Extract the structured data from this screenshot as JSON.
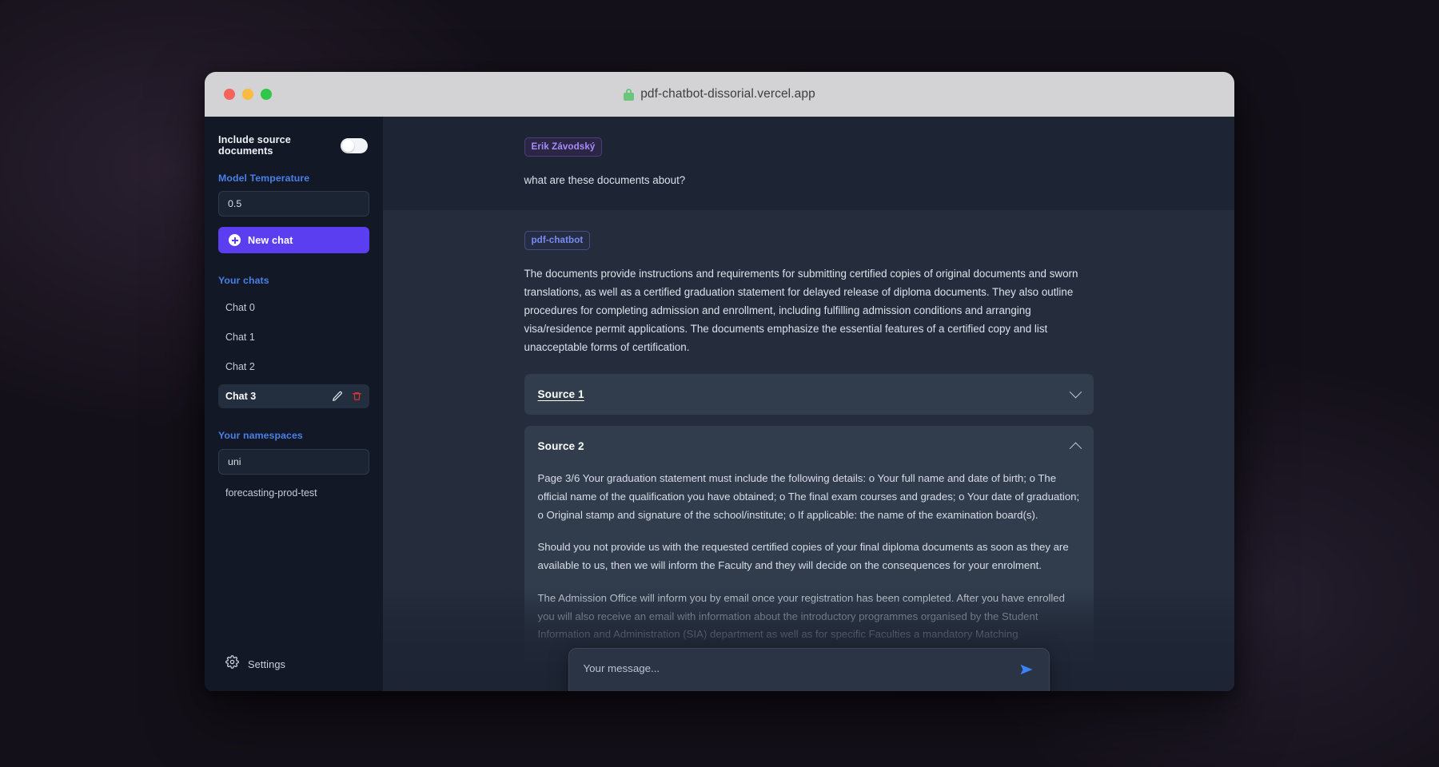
{
  "browser": {
    "url": "pdf-chatbot-dissorial.vercel.app",
    "lock_icon": "lock-icon",
    "traffic_lights": [
      "close-red",
      "minimize-yellow",
      "maximize-green"
    ]
  },
  "sidebar": {
    "include_source_documents": {
      "label": "Include source documents",
      "enabled": false
    },
    "model_temperature": {
      "label": "Model Temperature",
      "value": "0.5"
    },
    "new_chat_button": {
      "label": "New chat",
      "icon": "plus-circle-icon"
    },
    "chats_section_title": "Your chats",
    "chats": [
      {
        "label": "Chat 0",
        "active": false
      },
      {
        "label": "Chat 1",
        "active": false
      },
      {
        "label": "Chat 2",
        "active": false
      },
      {
        "label": "Chat 3",
        "active": true
      }
    ],
    "chat_actions": {
      "edit_icon": "pencil-icon",
      "delete_icon": "trash-icon"
    },
    "namespaces_section_title": "Your namespaces",
    "namespace_selected": "uni",
    "namespaces": [
      {
        "label": "forecasting-prod-test"
      }
    ],
    "settings": {
      "label": "Settings",
      "icon": "gear-icon"
    }
  },
  "conversation": [
    {
      "role": "user",
      "badge": "Erik Závodský",
      "text": "what are these documents about?"
    },
    {
      "role": "bot",
      "badge": "pdf-chatbot",
      "text": "The documents provide instructions and requirements for submitting certified copies of original documents and sworn translations, as well as a certified graduation statement for delayed release of diploma documents. They also outline procedures for completing admission and enrollment, including fulfilling admission conditions and arranging visa/residence permit applications. The documents emphasize the essential features of a certified copy and list unacceptable forms of certification."
    }
  ],
  "sources": [
    {
      "title": "Source 1",
      "expanded": false,
      "chevron": "chevron-down-icon",
      "paragraphs": []
    },
    {
      "title": "Source 2",
      "expanded": true,
      "chevron": "chevron-up-icon",
      "paragraphs": [
        "Page 3/6 Your graduation statement must include the following details: o Your full name and date of birth; o The official name of the qualification you have obtained; o The final exam courses and grades; o Your date of graduation; o Original stamp and signature of the school/institute; o If applicable: the name of the examination board(s).",
        "Should you not provide us with the requested certified copies of your final diploma documents as soon as they are available to us, then we will inform the Faculty and they will decide on the consequences for your enrolment.",
        "The Admission Office will inform you by email once your registration has been completed. After you have enrolled you will also receive an email with information about the introductory programmes organised by the Student Information and Administration (SIA) department as well as for specific Faculties a mandatory Matching"
      ]
    }
  ],
  "composer": {
    "placeholder": "Your message...",
    "value": "",
    "send_icon": "send-paper-plane-icon"
  },
  "colors": {
    "accent_primary": "#5b3ef0",
    "accent_link": "#4a7fe8",
    "badge_user": "#a78bfa",
    "badge_bot": "#7a8cf0",
    "send_blue": "#3b82f6",
    "delete_red": "#e3342f"
  }
}
